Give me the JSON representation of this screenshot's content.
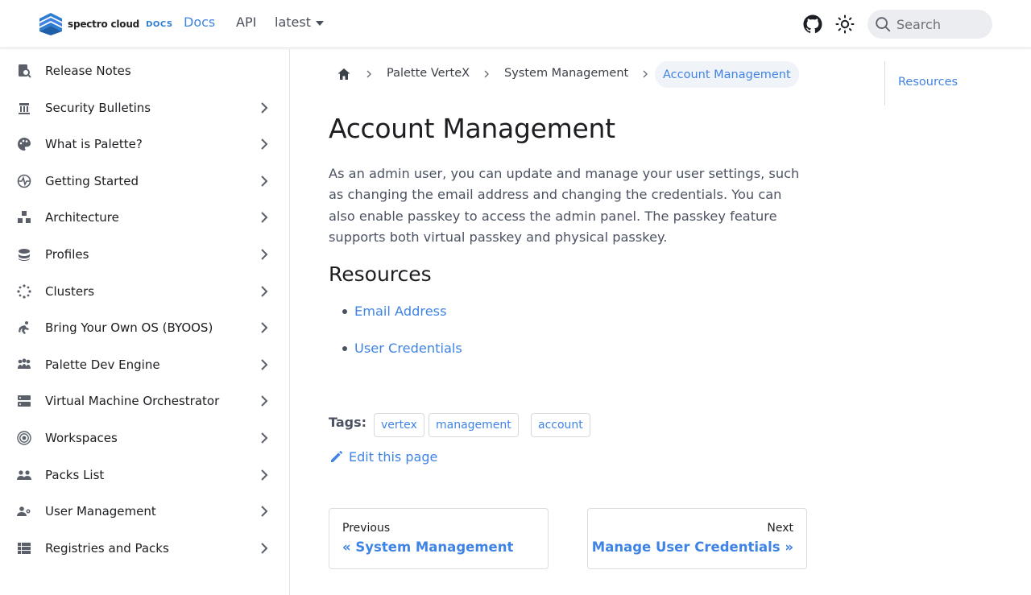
{
  "navbar": {
    "brand_name": "spectro cloud",
    "brand_docs": "DOCS",
    "links": [
      "Docs",
      "API",
      "latest"
    ],
    "search_placeholder": "Search",
    "icons": [
      "github-icon",
      "theme-toggle-sun-icon",
      "search-icon"
    ]
  },
  "sidebar": {
    "items": [
      {
        "label": "Release Notes",
        "icon": "release-notes-icon",
        "expandable": false
      },
      {
        "label": "Security Bulletins",
        "icon": "security-icon",
        "expandable": true
      },
      {
        "label": "What is Palette?",
        "icon": "palette-icon",
        "expandable": true
      },
      {
        "label": "Getting Started",
        "icon": "getting-started-icon",
        "expandable": true
      },
      {
        "label": "Architecture",
        "icon": "architecture-icon",
        "expandable": true
      },
      {
        "label": "Profiles",
        "icon": "profiles-icon",
        "expandable": true
      },
      {
        "label": "Clusters",
        "icon": "clusters-icon",
        "expandable": true
      },
      {
        "label": "Bring Your Own OS (BYOOS)",
        "icon": "byoos-icon",
        "expandable": true
      },
      {
        "label": "Palette Dev Engine",
        "icon": "dev-engine-icon",
        "expandable": true
      },
      {
        "label": "Virtual Machine Orchestrator",
        "icon": "vm-orchestrator-icon",
        "expandable": true
      },
      {
        "label": "Workspaces",
        "icon": "workspaces-icon",
        "expandable": true
      },
      {
        "label": "Packs List",
        "icon": "packs-list-icon",
        "expandable": true
      },
      {
        "label": "User Management",
        "icon": "user-management-icon",
        "expandable": true
      },
      {
        "label": "Registries and Packs",
        "icon": "registries-icon",
        "expandable": true
      }
    ]
  },
  "breadcrumb": {
    "items": [
      "Palette VerteX",
      "System Management"
    ],
    "current": "Account Management"
  },
  "main": {
    "title": "Account Management",
    "intro": "As an admin user, you can update and manage your user settings, such as changing the email address and changing the credentials. You can also enable passkey to access the admin panel. The passkey feature supports both virtual passkey and physical passkey.",
    "resources_heading": "Resources",
    "resources": [
      "Email Address",
      "User Credentials"
    ],
    "tags_label": "Tags:",
    "tags": [
      "vertex",
      "management",
      "account"
    ],
    "edit_label": "Edit this page"
  },
  "pagination": {
    "prev_sub": "Previous",
    "prev_label": "« System Management",
    "next_sub": "Next",
    "next_label": "Manage User Credentials »"
  },
  "toc": {
    "items": [
      "Resources"
    ]
  },
  "colors": {
    "accent": "#3f84e5",
    "text": "#1c1e21",
    "body_text": "#4b5262",
    "border": "#dadde1"
  }
}
